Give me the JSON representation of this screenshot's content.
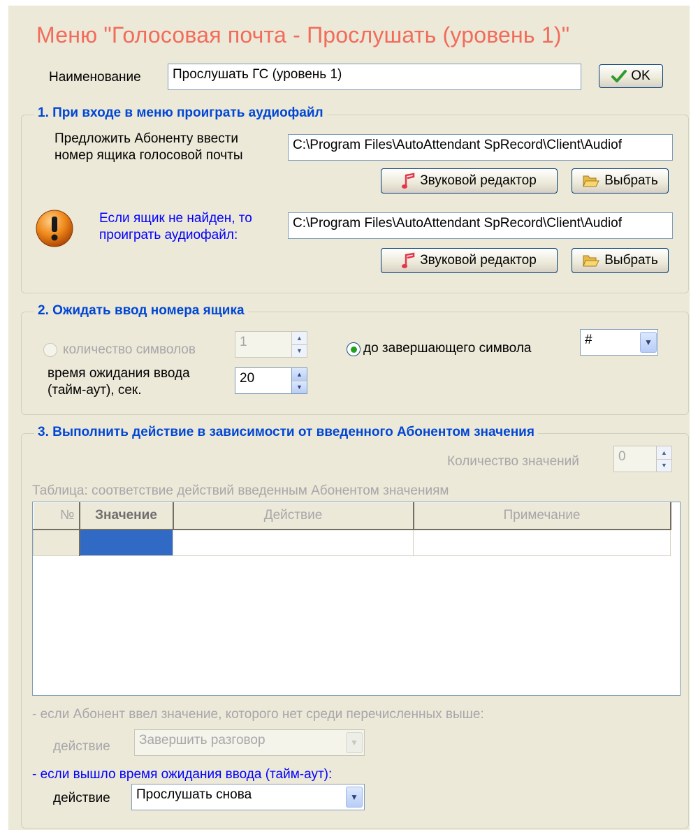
{
  "title": "Меню \"Голосовая почта - Прослушать (уровень 1)\"",
  "name_row": {
    "label": "Наименование",
    "value": "Прослушать ГС (уровень 1)",
    "ok_label": "OK"
  },
  "section1": {
    "title": "1. При входе в меню проиграть аудиофайл",
    "prompt_label_line1": "Предложить Абоненту ввести",
    "prompt_label_line2": "номер ящика голосовой почты",
    "prompt_path": "C:\\Program Files\\AutoAttendant SpRecord\\Client\\Audiof",
    "editor_label": "Звуковой редактор",
    "choose_label": "Выбрать",
    "notfound_label_line1": "Если ящик не найден, то",
    "notfound_label_line2": "проиграть аудиофайл:",
    "notfound_path": "C:\\Program Files\\AutoAttendant SpRecord\\Client\\Audiof",
    "editor2_label": "Звуковой редактор",
    "choose2_label": "Выбрать"
  },
  "section2": {
    "title": "2. Ожидать ввод номера ящика",
    "count_label": "количество символов",
    "count_value": "1",
    "terminal_label": "до завершающего символа",
    "terminal_value": "#",
    "timeout_label_line1": "время ожидания ввода",
    "timeout_label_line2": "(тайм-аут), сек.",
    "timeout_value": "20"
  },
  "section3": {
    "title": "3. Выполнить действие в зависимости от введенного Абонентом значения",
    "count_values_label": "Количество значений",
    "count_values_value": "0",
    "table_caption": "Таблица: соответствие действий введенным Абонентом значениям",
    "columns": [
      "№",
      "Значение",
      "Действие",
      "Примечание"
    ],
    "unknown_label": "- если Абонент ввел значение, которого нет среди перечисленных выше:",
    "unknown_action_label": "действие",
    "unknown_action_value": "Завершить разговор",
    "timeout_label": "- если вышло время ожидания ввода (тайм-аут):",
    "timeout_action_label": "действие",
    "timeout_action_value": "Прослушать снова"
  }
}
